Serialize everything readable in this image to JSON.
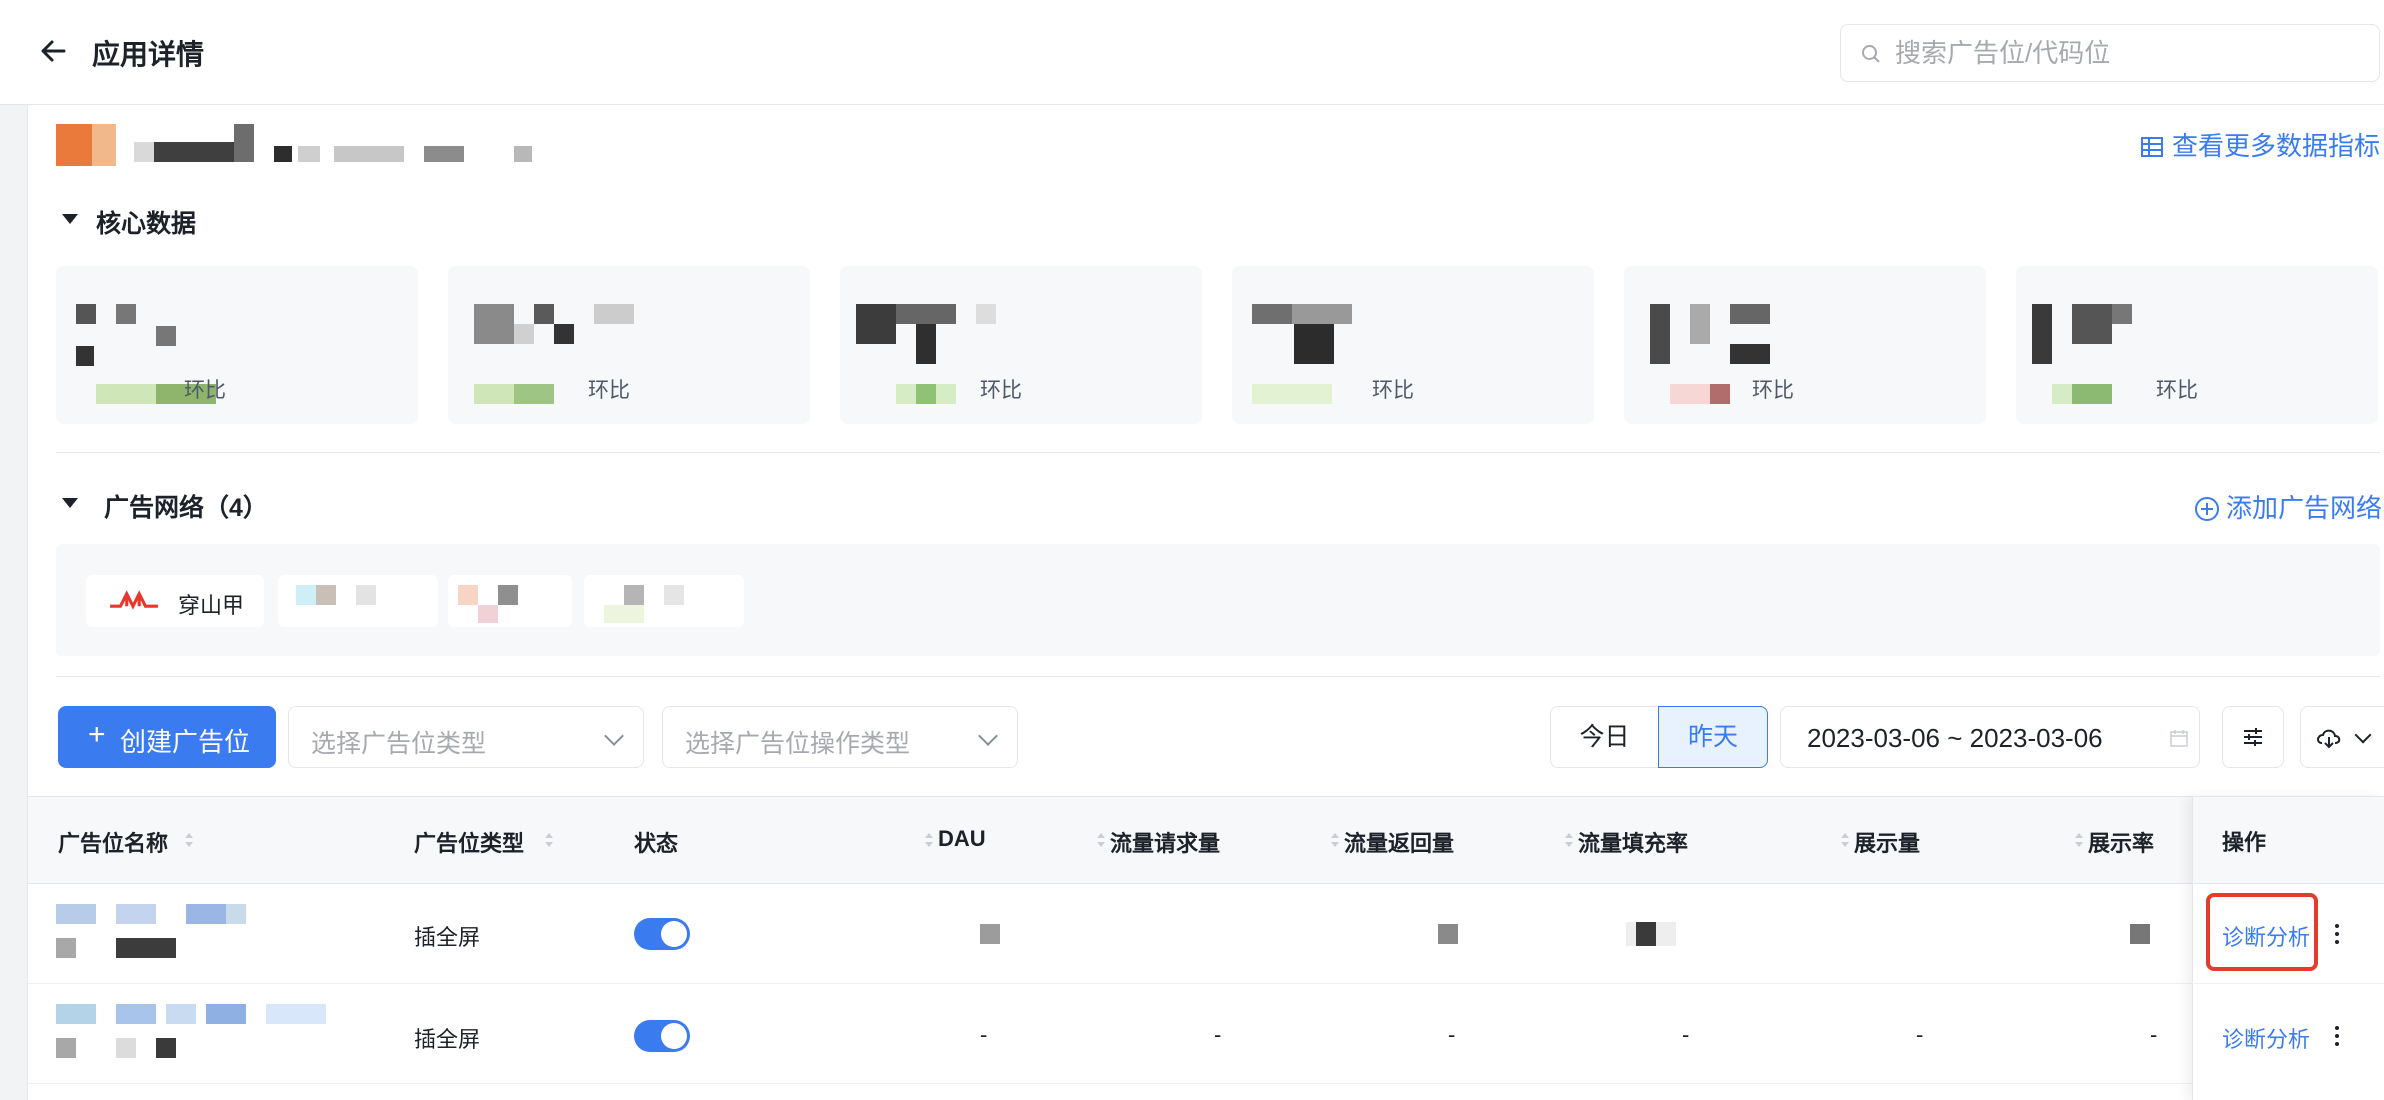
{
  "header": {
    "title": "应用详情",
    "search_placeholder": "搜索广告位/代码位"
  },
  "overview": {
    "more_metrics_label": "查看更多数据指标"
  },
  "core_section": {
    "title": "核心数据",
    "cards": [
      {
        "ratio_label": "环比"
      },
      {
        "ratio_label": "环比"
      },
      {
        "ratio_label": "环比"
      },
      {
        "ratio_label": "环比"
      },
      {
        "ratio_label": "环比"
      },
      {
        "ratio_label": "环比"
      }
    ]
  },
  "network_section": {
    "title": "广告网络（4）",
    "add_label": "添加广告网络",
    "networks": [
      {
        "name": "穿山甲"
      }
    ]
  },
  "toolbar": {
    "create_plus": "+",
    "create_label": "创建广告位",
    "type_placeholder": "选择广告位类型",
    "op_type_placeholder": "选择广告位操作类型",
    "today_label": "今日",
    "yesterday_label": "昨天",
    "date_range": "2023-03-06 ~ 2023-03-06"
  },
  "table": {
    "columns": [
      "广告位名称",
      "广告位类型",
      "状态",
      "DAU",
      "流量请求量",
      "流量返回量",
      "流量填充率",
      "展示量",
      "展示率",
      "操作"
    ],
    "rows": [
      {
        "type": "插全屏",
        "status_on": true,
        "dau": "",
        "requests": "",
        "returns": "",
        "fill_rate": "",
        "impressions": "",
        "show_rate": "",
        "action": "诊断分析"
      },
      {
        "type": "插全屏",
        "status_on": true,
        "dau": "-",
        "requests": "-",
        "returns": "-",
        "fill_rate": "-",
        "impressions": "-",
        "show_rate": "-",
        "action": "诊断分析"
      }
    ]
  },
  "colors": {
    "accent": "#3a7cf0",
    "highlight_box": "#e53b2c",
    "pangle_logo": "#e8372c"
  },
  "icons": [
    "back-arrow-icon",
    "search-icon",
    "table-grid-icon",
    "plus-circle-icon",
    "calendar-icon",
    "settings-sliders-icon",
    "cloud-download-icon",
    "more-vertical-icon"
  ]
}
